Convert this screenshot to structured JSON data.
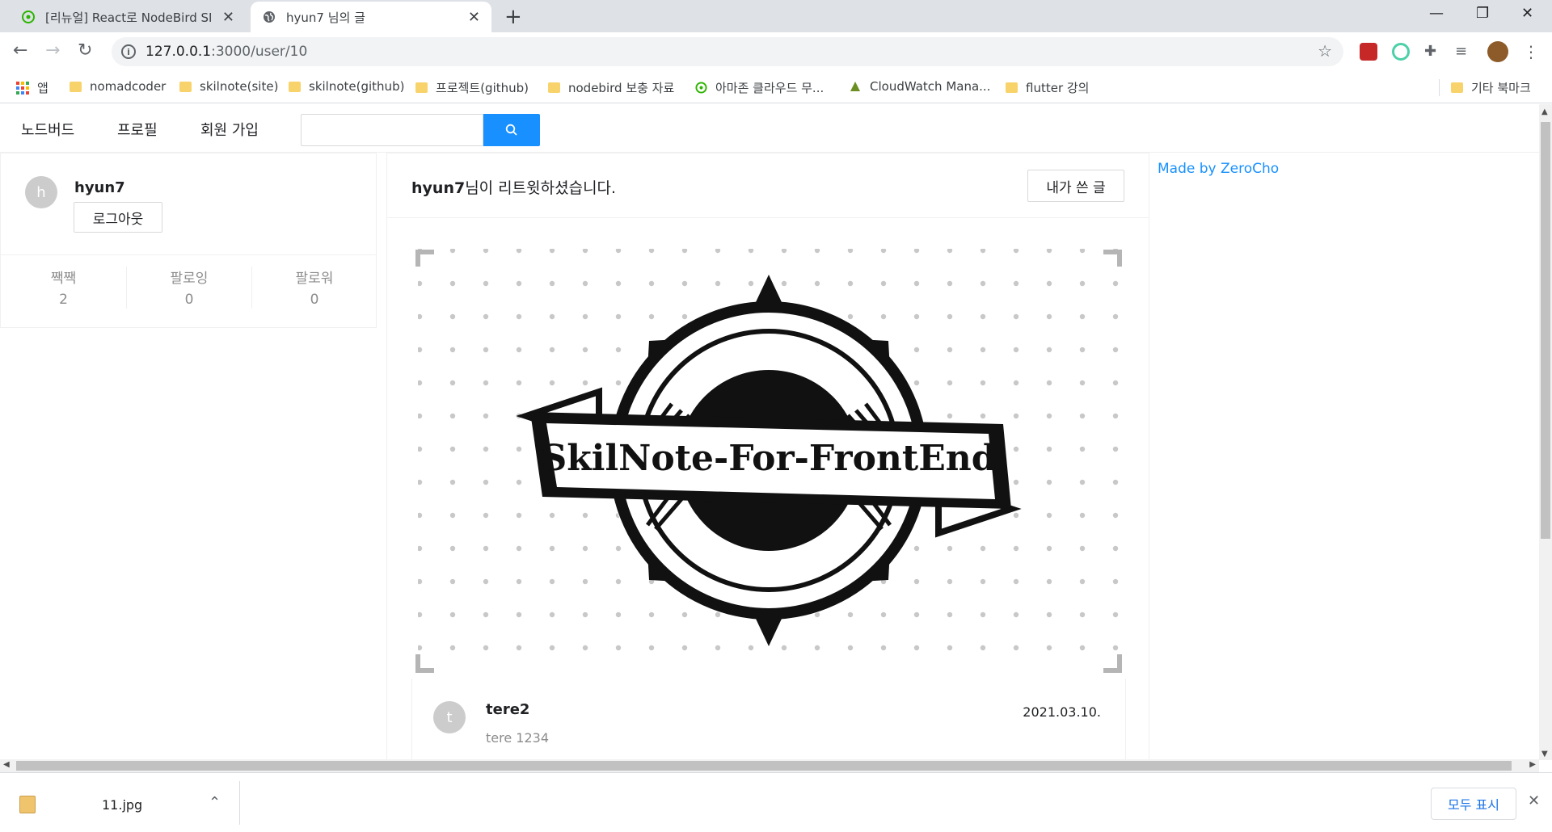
{
  "browser": {
    "tabs": [
      {
        "title": "[리뉴얼] React로 NodeBird SNS"
      },
      {
        "title": "hyun7 님의 글"
      }
    ],
    "url_host": "127.0.0.1",
    "url_path": ":3000/user/10",
    "bookmarks": [
      {
        "label": "앱"
      },
      {
        "label": "nomadcoder"
      },
      {
        "label": "skilnote(site)"
      },
      {
        "label": "skilnote(github)"
      },
      {
        "label": "프로젝트(github)"
      },
      {
        "label": "nodebird 보충 자료"
      },
      {
        "label": "아마존 클라우드 무..."
      },
      {
        "label": "CloudWatch Mana..."
      },
      {
        "label": "flutter 강의"
      }
    ],
    "other_bookmarks": "기타 북마크"
  },
  "menu": {
    "items": [
      {
        "label": "노드버드"
      },
      {
        "label": "프로필"
      },
      {
        "label": "회원 가입"
      }
    ],
    "search_placeholder": ""
  },
  "user_card": {
    "avatar_letter": "h",
    "nickname": "hyun7",
    "logout_label": "로그아웃",
    "stats": [
      {
        "label": "짹짹",
        "value": "2"
      },
      {
        "label": "팔로잉",
        "value": "0"
      },
      {
        "label": "팔로워",
        "value": "0"
      }
    ]
  },
  "post": {
    "retweeter": "hyun7",
    "retweet_text": "님이 리트윗하셨습니다.",
    "my_posts_label": "내가 쓴 글",
    "image_text": "SkilNote-For-FrontEnd",
    "author_avatar_letter": "t",
    "author": "tere2",
    "date": "2021.03.10.",
    "content": "tere 1234"
  },
  "sidebar": {
    "made_by": "Made by ZeroCho"
  },
  "downloads": {
    "file_name": "11.jpg",
    "show_all_label": "모두 표시"
  }
}
